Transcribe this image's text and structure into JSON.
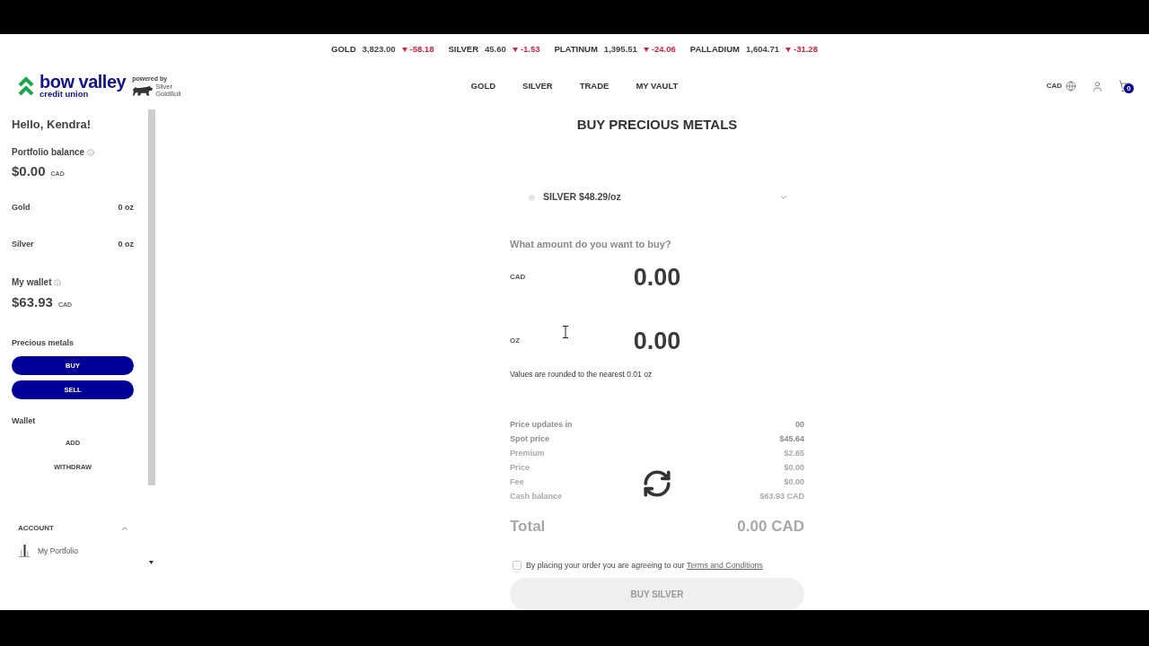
{
  "ticker": [
    {
      "metal": "GOLD",
      "price": "3,823.00",
      "change": "-58.18"
    },
    {
      "metal": "SILVER",
      "price": "45.60",
      "change": "-1.53"
    },
    {
      "metal": "PLATINUM",
      "price": "1,395.51",
      "change": "-24.06"
    },
    {
      "metal": "PALLADIUM",
      "price": "1,604.71",
      "change": "-31.28"
    }
  ],
  "logo": {
    "name": "bow valley",
    "tagline": "credit union",
    "powered_by": "powered by",
    "partner": [
      "Silver",
      "GoldBull"
    ]
  },
  "nav": [
    "GOLD",
    "SILVER",
    "TRADE",
    "MY VAULT"
  ],
  "header_actions": {
    "currency": "CAD",
    "cart_count": "0"
  },
  "sidebar": {
    "greeting": "Hello, Kendra!",
    "portfolio": {
      "label": "Portfolio balance",
      "amount": "$0.00",
      "currency": "CAD"
    },
    "holdings": [
      {
        "metal": "Gold",
        "amount": "0 oz"
      },
      {
        "metal": "Silver",
        "amount": "0 oz"
      }
    ],
    "wallet": {
      "label": "My wallet",
      "amount": "$63.93",
      "currency": "CAD"
    },
    "precious_metals": {
      "heading": "Precious metals",
      "buttons": [
        "BUY",
        "SELL"
      ]
    },
    "wallet_actions": {
      "heading": "Wallet",
      "buttons": [
        "ADD",
        "WITHDRAW"
      ]
    },
    "account": {
      "heading": "ACCOUNT",
      "expanded": true,
      "items": [
        "My Portfolio"
      ]
    }
  },
  "main": {
    "title": "BUY PRECIOUS METALS",
    "metal_select": {
      "value": "SILVER $48.29/oz"
    },
    "question": "What amount do you want to buy?",
    "amounts": [
      {
        "unit": "CAD",
        "value": "0.00"
      },
      {
        "unit": "OZ",
        "value": "0.00"
      }
    ],
    "note": "Values are rounded to the nearest 0.01 oz",
    "summary": [
      {
        "label": "Price updates in",
        "value": "00",
        "faded": false
      },
      {
        "label": "Spot price",
        "value": "$45.64",
        "faded": false
      },
      {
        "label": "Premium",
        "value": "$2.65",
        "faded": true
      },
      {
        "label": "Price",
        "value": "$0.00",
        "faded": true
      },
      {
        "label": "Fee",
        "value": "$0.00",
        "faded": true
      },
      {
        "label": "Cash balance",
        "value": "$63.93 CAD",
        "faded": true
      }
    ],
    "total": {
      "label": "Total",
      "value": "0.00 CAD"
    },
    "terms": {
      "text": "By placing your order you are agreeing to our",
      "link": "Terms and Conditions",
      "checked": false
    },
    "submit": {
      "label": "BUY SILVER",
      "disabled": true
    }
  }
}
